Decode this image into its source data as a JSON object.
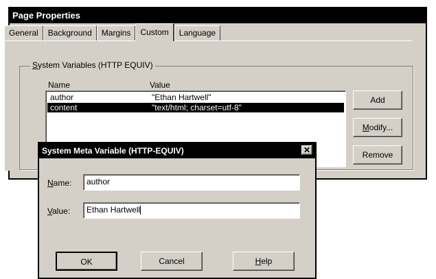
{
  "page_properties": {
    "title": "Page Properties",
    "tabs": [
      "General",
      "Background",
      "Margins",
      "Custom",
      "Language"
    ],
    "active_tab": "Custom",
    "group_label_underlined": "S",
    "group_label_rest": "ystem Variables (HTTP EQUIV)",
    "columns": {
      "name": "Name",
      "value": "Value"
    },
    "rows": [
      {
        "name": "author",
        "value": "\"Ethan Hartwell\""
      },
      {
        "name": "content",
        "value": "\"text/html; charset=utf-8\""
      }
    ],
    "selected_row": 1,
    "buttons": {
      "add": "Add",
      "modify_u": "M",
      "modify_rest": "odify...",
      "remove": "Remove"
    }
  },
  "meta_dialog": {
    "title": "System Meta Variable (HTTP-EQUIV)",
    "close_glyph": "✕",
    "name_label_u": "N",
    "name_label_rest": "ame:",
    "name_value": "author",
    "value_label_u": "V",
    "value_label_rest": "alue:",
    "value_value": "Ethan Hartwell",
    "ok": "OK",
    "cancel": "Cancel",
    "help_u": "H",
    "help_rest": "elp"
  }
}
